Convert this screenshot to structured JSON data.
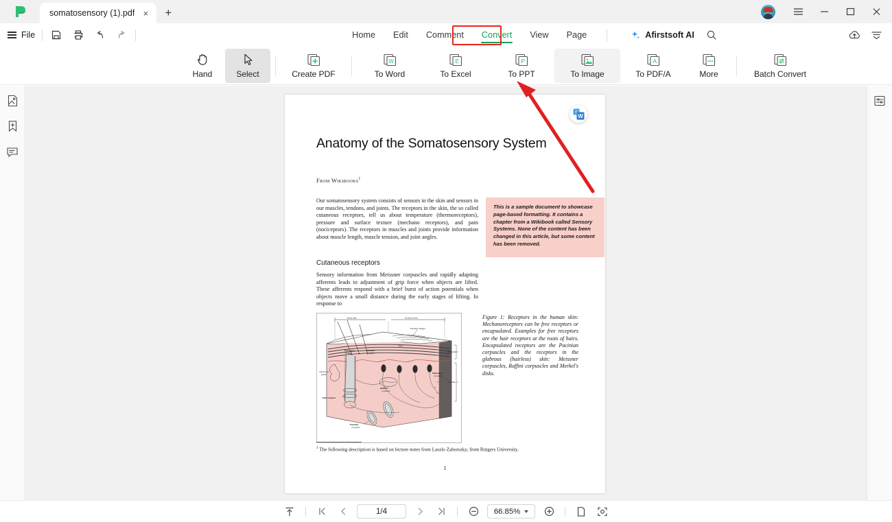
{
  "titlebar": {
    "logo_icon": "afirstsoft-logo-icon",
    "tab": {
      "title": "somatosensory (1).pdf",
      "close_glyph": "×"
    },
    "new_tab_glyph": "+",
    "avatar_icon": "user-avatar",
    "menu_icon": "hamburger-menu-icon",
    "minimize_glyph": "—",
    "maximize_glyph": "□",
    "close_glyph": "✕"
  },
  "menubar": {
    "file_label": "File",
    "quick_actions": [
      "save-icon",
      "print-icon",
      "undo-icon",
      "redo-icon"
    ],
    "tabs": [
      {
        "label": "Home",
        "active": false
      },
      {
        "label": "Edit",
        "active": false
      },
      {
        "label": "Comment",
        "active": false
      },
      {
        "label": "Convert",
        "active": true
      },
      {
        "label": "View",
        "active": false
      },
      {
        "label": "Page",
        "active": false
      }
    ],
    "ai_label": "Afirstsoft AI",
    "search_icon": "search-icon",
    "right_icons": [
      "cloud-upload-icon",
      "collapse-ribbon-icon"
    ],
    "active_accent": "#13a05a",
    "annotation_color": "#e8251e"
  },
  "ribbon": {
    "items": [
      {
        "label": "Hand",
        "icon": "hand-icon",
        "state": "normal"
      },
      {
        "label": "Select",
        "icon": "cursor-select-icon",
        "state": "active"
      },
      {
        "label": "Create PDF",
        "icon": "create-pdf-icon",
        "badge": "+",
        "state": "normal"
      },
      {
        "label": "To Word",
        "icon": "to-word-icon",
        "badge": "W",
        "state": "normal"
      },
      {
        "label": "To Excel",
        "icon": "to-excel-icon",
        "badge": "E",
        "state": "normal"
      },
      {
        "label": "To PPT",
        "icon": "to-ppt-icon",
        "badge": "P",
        "state": "normal"
      },
      {
        "label": "To Image",
        "icon": "to-image-icon",
        "badge": "image",
        "state": "hover"
      },
      {
        "label": "To PDF/A",
        "icon": "to-pdfa-icon",
        "badge": "A",
        "state": "normal"
      },
      {
        "label": "More",
        "icon": "more-icon",
        "badge": "...",
        "state": "normal"
      },
      {
        "label": "Batch Convert",
        "icon": "batch-convert-icon",
        "badge": "swap",
        "state": "normal"
      }
    ]
  },
  "left_rail": {
    "items": [
      {
        "icon": "thumbnails-icon",
        "name": "page-thumbnails"
      },
      {
        "icon": "bookmark-add-icon",
        "name": "bookmarks"
      },
      {
        "icon": "comment-icon",
        "name": "comments"
      }
    ]
  },
  "right_rail": {
    "items": [
      {
        "icon": "properties-panel-icon",
        "name": "properties"
      }
    ]
  },
  "document": {
    "title": "Anatomy of the Somatosensory System",
    "source": "From Wikibooks",
    "source_footnote_marker": "1",
    "paragraph1": "Our somatosensory system consists of sensors in the skin and sensors in our muscles, tendons, and joints. The receptors in the skin, the so called cutaneous receptors, tell us about temperature (thermoreceptors), pressure and surface texture (mechano receptors), and pain (nociceptors). The receptors in muscles and joints provide information about muscle length, muscle tension, and joint angles.",
    "callout": "This is a sample document to showcase page-based formatting. It contains a chapter from a Wikibook called Sensory Systems. None of the content has been changed in this article, but some content has been removed.",
    "section_heading": "Cutaneous receptors",
    "paragraph2": "Sensory information from Meissner corpuscles and rapidly adapting afferents leads to adjustment of grip force when objects are lifted. These afferents respond with a brief burst of action potentials when objects move a small distance during the early stages of lifting. In response to",
    "figure_caption": "Figure 1: Receptors in the human skin: Mechanoreceptors can be free receptors or encapsulated. Examples for free receptors are the hair receptors at the roots of hairs. Encapsulated receptors are the Pacinian corpuscles and the receptors in the glabrous (hairless) skin: Meissner corpuscles, Ruffini corpuscles and Merkel's disks.",
    "figure_labels": {
      "hairy_skin": "Hairy skin",
      "glabrous_skin": "Glabrous skin",
      "papillary_ridges": "Papillary Ridges",
      "septa": "Septa",
      "epidermis": "Epidermis",
      "dermis": "Dermis",
      "free_nerve": "Free nerve endings",
      "merkel": "Merkel's receptor",
      "meissner": "Meissner's corpuscle",
      "ruffini": "Ruffini's corpuscle",
      "sebaceous": "Sebaceous gland",
      "hair_receptor": "Hair receptor",
      "pacinian": "Pacinian corpuscle"
    },
    "footnote_marker": "1",
    "footnote": "The following description is based on lecture notes from Laszlo Zaborszky, from Rutgers University.",
    "page_number": "1",
    "word_badge_icon": "convert-to-word-badge"
  },
  "statusbar": {
    "fit_icon": "fit-page-icon",
    "first_page_icon": "first-page-icon",
    "prev_page_icon": "previous-page-icon",
    "page_indicator": "1/4",
    "next_page_icon": "next-page-icon",
    "last_page_icon": "last-page-icon",
    "zoom_out_icon": "zoom-out-icon",
    "zoom_level": "66.85%",
    "zoom_in_icon": "zoom-in-icon",
    "single_page_icon": "single-page-view-icon",
    "fullscreen_icon": "fullscreen-icon"
  }
}
